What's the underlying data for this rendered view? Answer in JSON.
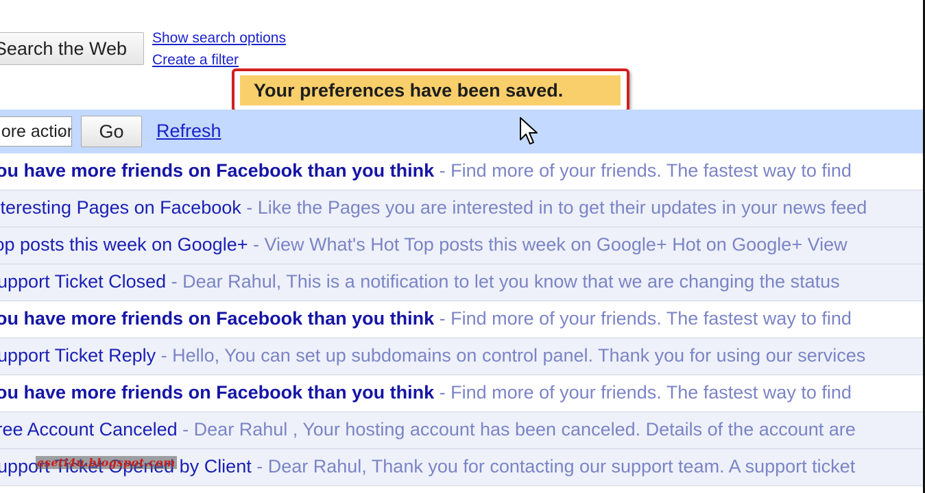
{
  "search": {
    "search_web_label": "Search the Web",
    "show_options_link": "Show search options",
    "create_filter_link": "Create a filter"
  },
  "notification": {
    "message": "Your preferences have been saved.",
    "highlight_color": "#d21f1f",
    "background_color": "#f9cf6b"
  },
  "toolbar": {
    "more_actions_value": "More actions...",
    "go_label": "Go",
    "refresh_label": "Refresh",
    "background_color": "#c3d9ff"
  },
  "messages": [
    {
      "subject": "You have more friends on Facebook than you think",
      "separator": " - ",
      "snippet": "Find more of your friends. The fastest way to find",
      "unread": true
    },
    {
      "subject": "Interesting Pages on Facebook",
      "separator": " - ",
      "snippet": "Like the Pages you are interested in to get their updates in your news feed",
      "unread": false
    },
    {
      "subject": "Top posts this week on Google+",
      "separator": " - ",
      "snippet": "View What's Hot Top posts this week on Google+ Hot on Google+ View",
      "unread": false
    },
    {
      "subject": "Support Ticket Closed",
      "separator": " - ",
      "snippet": "Dear Rahul, This is a notification to let you know that we are changing the status",
      "unread": false
    },
    {
      "subject": "You have more friends on Facebook than you think",
      "separator": " - ",
      "snippet": "Find more of your friends. The fastest way to find",
      "unread": true
    },
    {
      "subject": "Support Ticket Reply",
      "separator": " - ",
      "snippet": "Hello, You can set up subdomains on control panel. Thank you for using our services",
      "unread": false
    },
    {
      "subject": "You have more friends on Facebook than you think",
      "separator": " - ",
      "snippet": "Find more of your friends. The fastest way to find",
      "unread": true
    },
    {
      "subject": "Free Account Canceled",
      "separator": " - ",
      "snippet": "Dear Rahul , Your hosting account has been canceled. Details of the account are",
      "unread": false
    },
    {
      "subject": "Support Ticket Opened by Client",
      "separator": " - ",
      "snippet": "Dear Rahul, Thank you for contacting our support team. A support ticket",
      "unread": false
    }
  ],
  "watermark": "aseti4u.blogspot.com",
  "icons": {
    "cursor": "mouse-pointer-icon",
    "dropdown": "chevron-down-icon"
  }
}
